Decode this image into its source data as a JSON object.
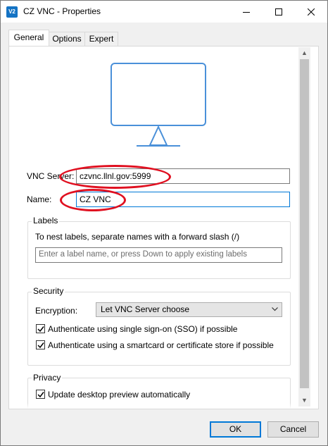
{
  "window": {
    "title": "CZ VNC - Properties",
    "icon_text": "V2",
    "controls": {
      "minimize": "minimize",
      "maximize": "maximize",
      "close": "close"
    }
  },
  "tabs": [
    {
      "label": "General",
      "active": true
    },
    {
      "label": "Options",
      "active": false
    },
    {
      "label": "Expert",
      "active": false
    }
  ],
  "general": {
    "preview_icon": "monitor-icon",
    "vnc_server_label": "VNC Server:",
    "vnc_server_value": "czvnc.llnl.gov:5999",
    "name_label": "Name:",
    "name_value": "CZ VNC",
    "labels_group": {
      "title": "Labels",
      "hint": "To nest labels, separate names with a forward slash (/)",
      "placeholder": "Enter a label name, or press Down to apply existing labels"
    },
    "security_group": {
      "title": "Security",
      "encryption_label": "Encryption:",
      "encryption_value": "Let VNC Server choose",
      "sso_label": "Authenticate using single sign-on (SSO) if possible",
      "sso_checked": true,
      "smartcard_label": "Authenticate using a smartcard or certificate store if possible",
      "smartcard_checked": true
    },
    "privacy_group": {
      "title": "Privacy",
      "preview_label": "Update desktop preview automatically",
      "preview_checked": true
    }
  },
  "footer": {
    "ok_label": "OK",
    "cancel_label": "Cancel"
  },
  "colors": {
    "accent": "#0078d7",
    "monitor": "#4a90d9",
    "annotation": "#e01020"
  }
}
